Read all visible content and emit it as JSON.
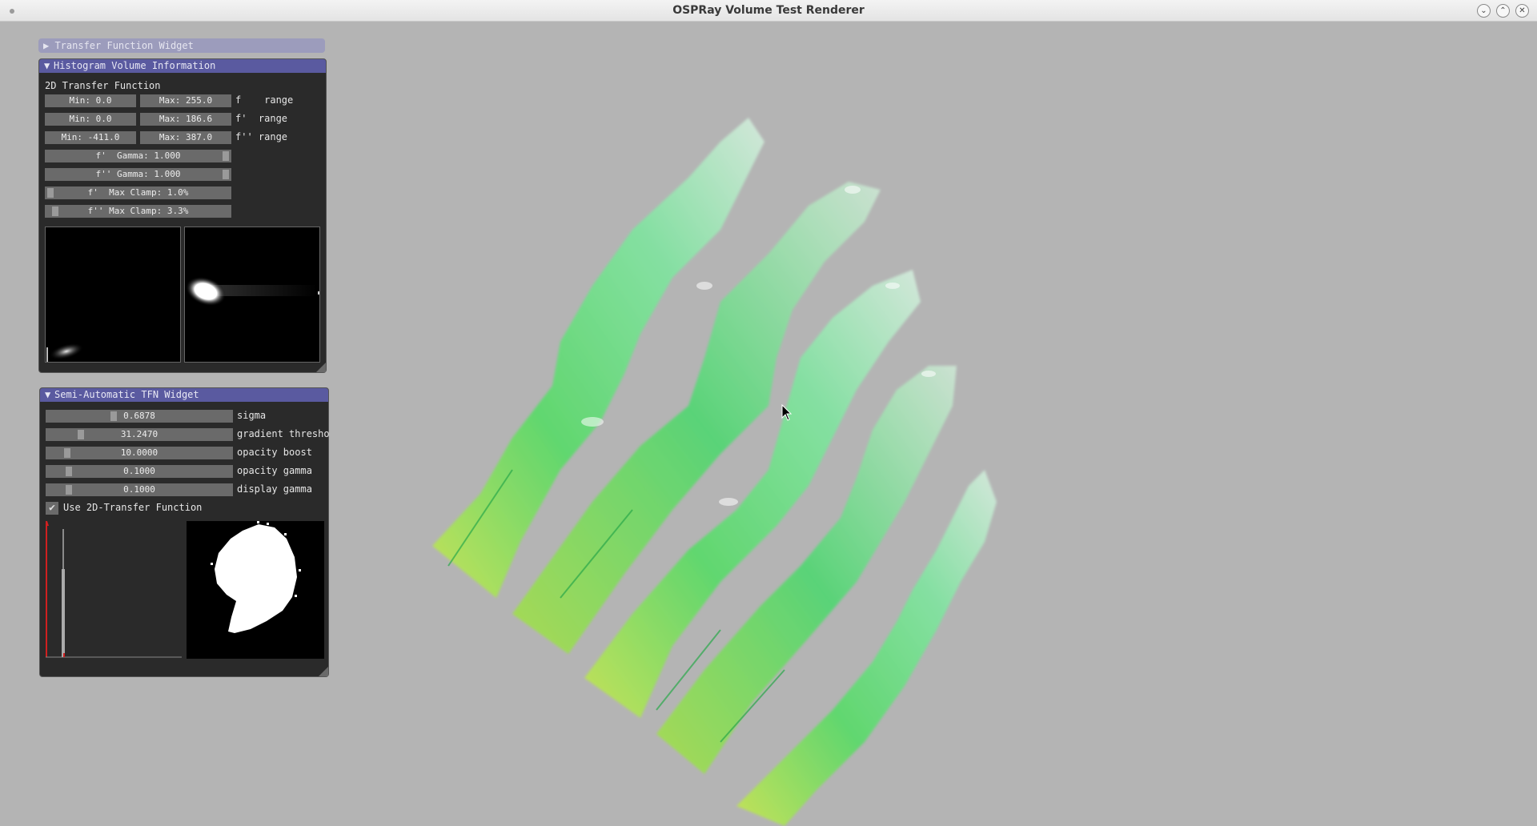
{
  "window": {
    "title": "OSPRay Volume Test Renderer",
    "buttons": [
      "minimize",
      "maximize",
      "close"
    ]
  },
  "tf_widget": {
    "header": "Transfer Function Widget",
    "collapsed": true
  },
  "histogram_panel": {
    "header": "Histogram Volume Information",
    "section_label": "2D Transfer Function",
    "ranges": [
      {
        "min": "Min: 0.0",
        "max": "Max: 255.0",
        "label": "f    range"
      },
      {
        "min": "Min: 0.0",
        "max": "Max: 186.6",
        "label": "f'  range"
      },
      {
        "min": "Min: -411.0",
        "max": "Max: 387.0",
        "label": "f'' range"
      }
    ],
    "sliders": [
      {
        "text": "f'  Gamma: 1.000",
        "value": 1.0
      },
      {
        "text": "f'' Gamma: 1.000",
        "value": 1.0
      },
      {
        "text": "f'  Max Clamp: 1.0%",
        "value": 0.01
      },
      {
        "text": "f'' Max Clamp: 3.3%",
        "value": 0.033
      }
    ]
  },
  "semi_auto_panel": {
    "header": "Semi-Automatic TFN Widget",
    "sliders": [
      {
        "value_text": "0.6878",
        "label": "sigma",
        "level": 0.35
      },
      {
        "value_text": "31.2470",
        "label": "gradient thresho",
        "level": 0.18
      },
      {
        "value_text": "10.0000",
        "label": "opacity boost",
        "level": 0.1
      },
      {
        "value_text": "0.1000",
        "label": "opacity gamma",
        "level": 0.1
      },
      {
        "value_text": "0.1000",
        "label": "display gamma",
        "level": 0.1
      }
    ],
    "checkbox": {
      "label": "Use 2D-Transfer Function",
      "checked": true,
      "mark": "✔"
    }
  },
  "colors": {
    "background": "#b4b4b4",
    "panel_bg": "#2a2a2a",
    "header": "#5a5aa0",
    "volume_green": "#4cd860",
    "field": "#6a6a6a"
  }
}
